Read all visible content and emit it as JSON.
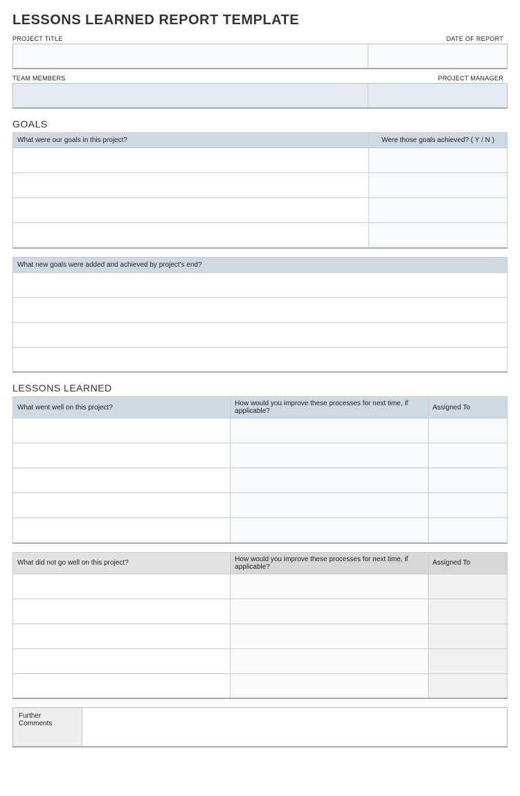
{
  "title": "LESSONS LEARNED REPORT TEMPLATE",
  "info": {
    "project_title_label": "PROJECT TITLE",
    "date_label": "DATE OF REPORT",
    "team_members_label": "TEAM MEMBERS",
    "pm_label": "PROJECT MANAGER",
    "project_title": "",
    "date": "",
    "team_members": "",
    "pm": ""
  },
  "goals": {
    "heading": "GOALS",
    "t1": {
      "col1": "What were our goals in this project?",
      "col2": "Were those goals achieved?  ( Y / N )",
      "rows": [
        {
          "goal": "",
          "yn": ""
        },
        {
          "goal": "",
          "yn": ""
        },
        {
          "goal": "",
          "yn": ""
        },
        {
          "goal": "",
          "yn": ""
        }
      ]
    },
    "t2": {
      "col1": "What new goals were added and achieved by project's end?",
      "rows": [
        {
          "val": ""
        },
        {
          "val": ""
        },
        {
          "val": ""
        },
        {
          "val": ""
        }
      ]
    }
  },
  "lessons": {
    "heading": "LESSONS LEARNED",
    "well": {
      "c1": "What went well on this project?",
      "c2": "How would you improve these processes for next time, if applicable?",
      "c3": "Assigned To",
      "rows": [
        {
          "a": "",
          "b": "",
          "c": ""
        },
        {
          "a": "",
          "b": "",
          "c": ""
        },
        {
          "a": "",
          "b": "",
          "c": ""
        },
        {
          "a": "",
          "b": "",
          "c": ""
        },
        {
          "a": "",
          "b": "",
          "c": ""
        }
      ]
    },
    "notwell": {
      "c1": "What did not go well on this project?",
      "c2": "How would you improve these processes for next time, if applicable?",
      "c3": "Assigned To",
      "rows": [
        {
          "a": "",
          "b": "",
          "c": ""
        },
        {
          "a": "",
          "b": "",
          "c": ""
        },
        {
          "a": "",
          "b": "",
          "c": ""
        },
        {
          "a": "",
          "b": "",
          "c": ""
        },
        {
          "a": "",
          "b": "",
          "c": ""
        }
      ]
    }
  },
  "comments": {
    "label": "Further Comments",
    "value": ""
  }
}
